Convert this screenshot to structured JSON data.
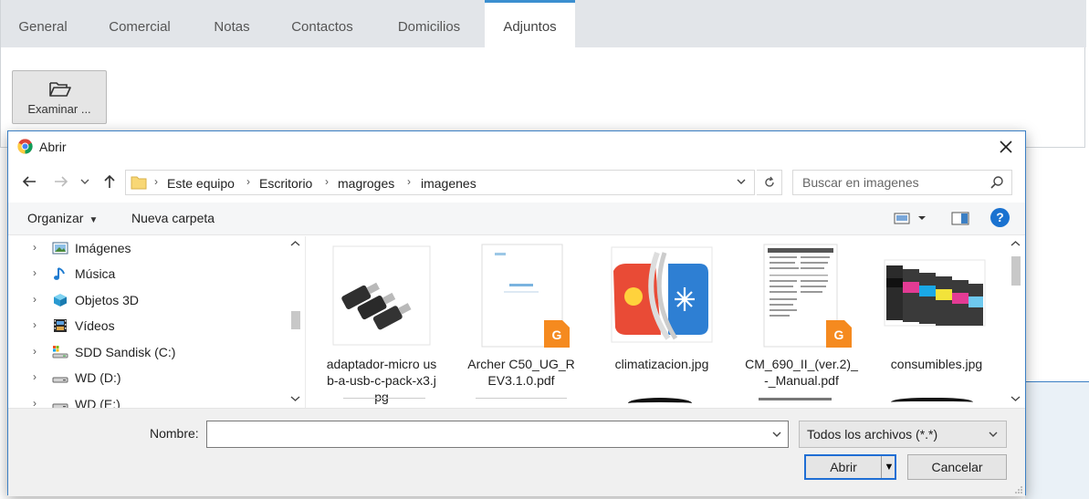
{
  "app": {
    "tabs": [
      {
        "label": "General"
      },
      {
        "label": "Comercial"
      },
      {
        "label": "Notas"
      },
      {
        "label": "Contactos"
      },
      {
        "label": "Domicilios"
      },
      {
        "label": "Adjuntos",
        "active": true
      }
    ],
    "examinar_label": "Examinar ...",
    "accent": "#3b8fd0"
  },
  "dialog": {
    "title": "Abrir",
    "breadcrumb": [
      "Este equipo",
      "Escritorio",
      "magroges",
      "imagenes"
    ],
    "search_placeholder": "Buscar en imagenes",
    "organizar": "Organizar",
    "nueva_carpeta": "Nueva carpeta",
    "tree": [
      {
        "label": "Imágenes",
        "icon": "pictures-folder-icon"
      },
      {
        "label": "Música",
        "icon": "music-note-icon"
      },
      {
        "label": "Objetos 3D",
        "icon": "cube-3d-icon"
      },
      {
        "label": "Vídeos",
        "icon": "film-icon"
      },
      {
        "label": "SDD Sandisk (C:)",
        "icon": "system-drive-icon"
      },
      {
        "label": "WD (D:)",
        "icon": "drive-icon"
      },
      {
        "label": "WD (E:)",
        "icon": "drive-icon"
      }
    ],
    "files": [
      {
        "name": "adaptador-micro usb-a-usb-c-pack-x3.jpg",
        "icon": "usb-adapters-thumb"
      },
      {
        "name": "Archer C50_UG_REV3.1.0.pdf",
        "icon": "pdf-thumb"
      },
      {
        "name": "climatizacion.jpg",
        "icon": "climate-thumb"
      },
      {
        "name": "CM_690_II_(ver.2)_-_Manual.pdf",
        "icon": "pdf-thumb"
      },
      {
        "name": "consumibles.jpg",
        "icon": "ink-cartridges-thumb"
      }
    ],
    "nombre_label": "Nombre:",
    "nombre_value": "",
    "filter_value": "Todos los archivos (*.*)",
    "abrir_label": "Abrir",
    "cancelar_label": "Cancelar",
    "help_glyph": "?"
  }
}
